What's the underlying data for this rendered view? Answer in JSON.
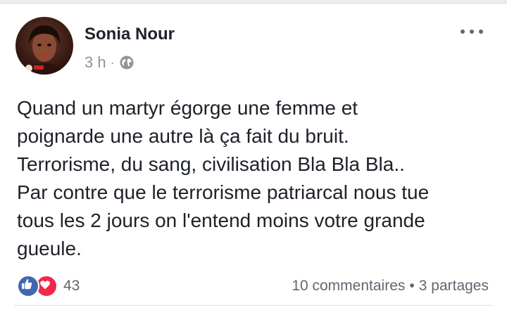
{
  "post": {
    "author": "Sonia Nour",
    "time": "3 h",
    "meta_separator": "·",
    "privacy_icon": "globe-icon",
    "more_icon": "ellipsis-icon",
    "text_lines": [
      "Quand un martyr égorge une femme et",
      "poignarde une autre là ça fait du bruit.",
      "Terrorisme, du sang, civilisation Bla Bla Bla..",
      "Par contre que le terrorisme patriarcal nous tue",
      "tous les 2 jours on l'entend moins votre grande",
      "gueule."
    ]
  },
  "footer": {
    "reactions": [
      "like-icon",
      "love-icon"
    ],
    "reaction_count": "43",
    "comments": "10 commentaires",
    "separator": "•",
    "shares": "3 partages"
  },
  "colors": {
    "like": "#4267b2",
    "love": "#f0284a",
    "text": "#1d2129",
    "meta": "#90949c"
  }
}
